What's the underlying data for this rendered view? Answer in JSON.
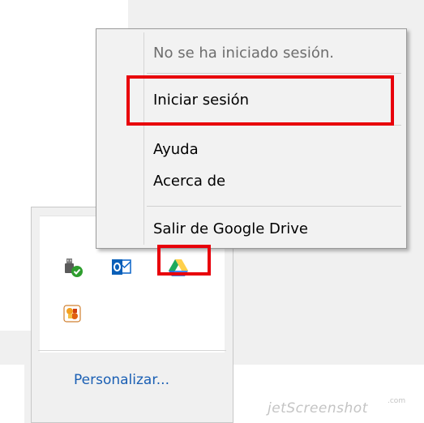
{
  "context_menu": {
    "status_text": "No se ha iniciado sesión.",
    "items": [
      {
        "label": "Iniciar sesión"
      },
      {
        "label": "Ayuda"
      },
      {
        "label": "Acerca de"
      },
      {
        "label": "Salir de Google Drive"
      }
    ]
  },
  "tray_flyout": {
    "icons": [
      "usb-safely-remove-icon",
      "outlook-icon",
      "google-drive-icon",
      "app-tray-icon"
    ],
    "customize_label": "Personalizar..."
  },
  "highlight_color": "#e8000b",
  "watermark": {
    "text": "jetScreenshot",
    "sub": ".com"
  }
}
